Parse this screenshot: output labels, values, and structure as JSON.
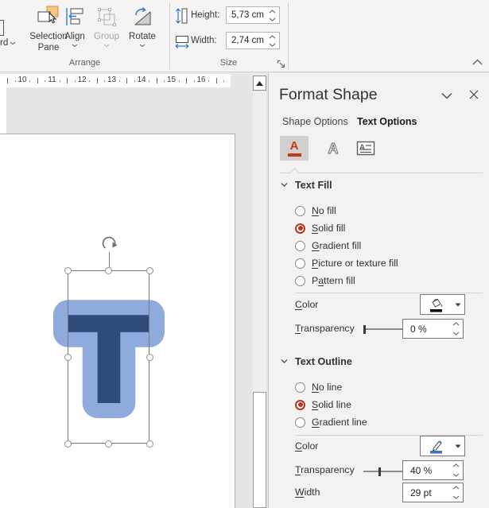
{
  "ribbon": {
    "partial_button": {
      "label": "rd"
    },
    "buttons": {
      "selection_pane": {
        "line1": "Selection",
        "line2": "Pane"
      },
      "align": {
        "label": "Align"
      },
      "group": {
        "label": "Group",
        "disabled": true
      },
      "rotate": {
        "label": "Rotate"
      }
    },
    "groups": {
      "arrange": "Arrange",
      "size": "Size"
    },
    "size_fields": {
      "height": {
        "label": "Height:",
        "value": "5,73 cm"
      },
      "width": {
        "label": "Width:",
        "value": "2,74 cm"
      }
    }
  },
  "ruler": {
    "numbers": [
      "10",
      "11",
      "12",
      "13",
      "14",
      "15",
      "16"
    ]
  },
  "canvas": {
    "letter": "T",
    "letter_fill": "#2E4B7A",
    "letter_outline": "#8FAADC"
  },
  "panel": {
    "title": "Format Shape",
    "tabs": {
      "shape_options": {
        "label": "Shape Options",
        "selected": false
      },
      "text_options": {
        "label": "Text Options",
        "selected": true
      }
    },
    "toolbar": {
      "text_fill_outline": {
        "name": "text-fill-and-outline",
        "glyph": "A",
        "selected": true,
        "accent": "#C23A17"
      },
      "text_effects": {
        "name": "text-effects",
        "glyph": "A",
        "selected": false
      },
      "textbox": {
        "name": "textbox",
        "glyph": "A",
        "selected": false
      }
    },
    "radio_accent": "#B5371E",
    "text_fill": {
      "header": "Text Fill",
      "options": [
        {
          "label": "No fill",
          "ak": 0,
          "selected": false
        },
        {
          "label": "Solid fill",
          "ak": 0,
          "selected": true
        },
        {
          "label": "Gradient fill",
          "ak": 0,
          "selected": false
        },
        {
          "label": "Picture or texture fill",
          "ak": 0,
          "selected": false
        },
        {
          "label": "Pattern fill",
          "ak": 1,
          "selected": false
        }
      ],
      "color": {
        "label": "Color",
        "ak": 0,
        "swatch": "#000000"
      },
      "transparency": {
        "label": "Transparency",
        "ak": 0,
        "value": "0 %",
        "slider_pos": 0
      }
    },
    "text_outline": {
      "header": "Text Outline",
      "options": [
        {
          "label": "No line",
          "ak": 0,
          "selected": false
        },
        {
          "label": "Solid line",
          "ak": 0,
          "selected": true
        },
        {
          "label": "Gradient line",
          "ak": 0,
          "selected": false
        }
      ],
      "color": {
        "label": "Color",
        "ak": 0,
        "swatch": "#4472C4"
      },
      "transparency": {
        "label": "Transparency",
        "ak": 0,
        "value": "40 %",
        "slider_pos": 0.4
      },
      "width": {
        "label": "Width",
        "ak": 0,
        "value": "29 pt"
      }
    }
  }
}
